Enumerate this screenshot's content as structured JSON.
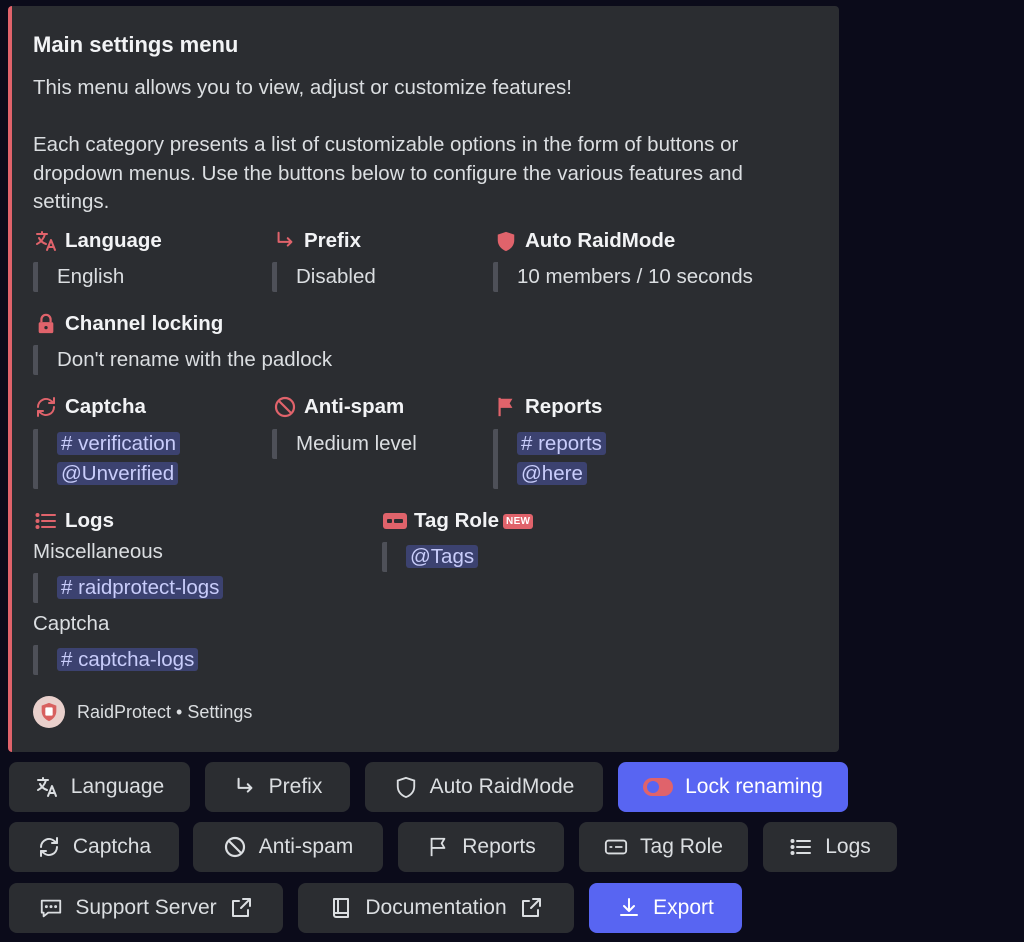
{
  "embed": {
    "title": "Main settings menu",
    "description": "This menu allows you to view, adjust or customize features!\n\nEach category presents a list of customizable options in the form of buttons or dropdown menus. Use the buttons below to configure the various features and settings.",
    "accent_color": "#e0636b",
    "fields": {
      "language": {
        "name": "Language",
        "icon": "translate-icon",
        "value": "English"
      },
      "prefix": {
        "name": "Prefix",
        "icon": "arrow-turn-icon",
        "value": "Disabled"
      },
      "auto_raidmode": {
        "name": "Auto RaidMode",
        "icon": "shield-icon",
        "value": "10 members / 10 seconds"
      },
      "channel_locking": {
        "name": "Channel locking",
        "icon": "padlock-icon",
        "value": "Don't rename with the padlock"
      },
      "captcha": {
        "name": "Captcha",
        "icon": "refresh-icon",
        "channel": "# verification",
        "role": "@Unverified"
      },
      "anti_spam": {
        "name": "Anti-spam",
        "icon": "prohibited-icon",
        "value": "Medium level"
      },
      "reports": {
        "name": "Reports",
        "icon": "flag-icon",
        "channel": "# reports",
        "role": "@here"
      },
      "logs": {
        "name": "Logs",
        "icon": "list-icon",
        "misc_label": "Miscellaneous",
        "misc_channel": "# raidprotect-logs",
        "captcha_label": "Captcha",
        "captcha_channel": "# captcha-logs"
      },
      "tag_role": {
        "name": "Tag Role",
        "icon": "id-card-icon",
        "badge": "NEW",
        "value": "@Tags"
      }
    },
    "footer": {
      "text": "RaidProtect • Settings"
    }
  },
  "buttons": {
    "language": "Language",
    "prefix": "Prefix",
    "auto_raidmode": "Auto RaidMode",
    "lock_renaming": "Lock renaming",
    "captcha": "Captcha",
    "anti_spam": "Anti-spam",
    "reports": "Reports",
    "tag_role": "Tag Role",
    "logs": "Logs",
    "support_server": "Support Server",
    "documentation": "Documentation",
    "export": "Export"
  },
  "colors": {
    "primary_button": "#5865f2",
    "secondary_button": "#2b2d31",
    "icon_accent": "#e0636b",
    "mention": "#c9cdfb"
  }
}
